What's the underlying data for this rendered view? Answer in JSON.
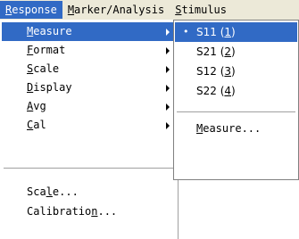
{
  "menubar": {
    "items": [
      {
        "accel": "R",
        "rest": "esponse"
      },
      {
        "accel": "M",
        "rest": "arker/Analysis"
      },
      {
        "accel": "S",
        "rest": "timulus"
      }
    ]
  },
  "menu": {
    "items": [
      {
        "accel": "M",
        "rest": "easure"
      },
      {
        "accel": "F",
        "rest": "ormat"
      },
      {
        "accel": "S",
        "rest": "cale"
      },
      {
        "accel": "D",
        "rest": "isplay"
      },
      {
        "accel": "A",
        "rest": "vg"
      },
      {
        "accel": "C",
        "rest": "al"
      }
    ],
    "scale_action": {
      "pre": "Sca",
      "accel": "l",
      "post": "e..."
    },
    "calibration_action": {
      "pre": "Calibratio",
      "accel": "n",
      "post": "..."
    }
  },
  "submenu": {
    "bullet": "•",
    "items": [
      {
        "label": "S11 (",
        "accel": "1",
        "close": ")"
      },
      {
        "label": "S21 (",
        "accel": "2",
        "close": ")"
      },
      {
        "label": "S12 (",
        "accel": "3",
        "close": ")"
      },
      {
        "label": "S22 (",
        "accel": "4",
        "close": ")"
      }
    ],
    "measure_dialog": {
      "accel": "M",
      "rest": "easure..."
    }
  },
  "colors": {
    "highlight": "#316ac5",
    "menubar": "#ece9d8"
  }
}
